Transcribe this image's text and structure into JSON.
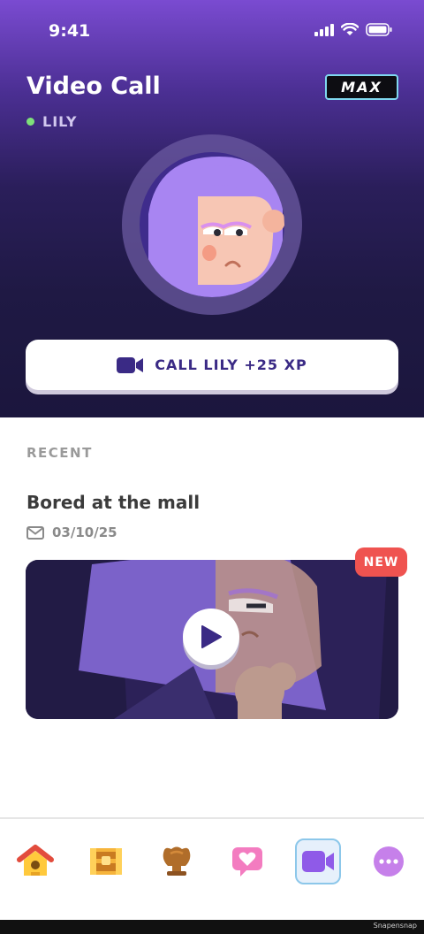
{
  "status": {
    "time": "9:41",
    "icons": [
      "signal-icon",
      "wifi-icon",
      "battery-icon"
    ]
  },
  "header": {
    "title": "Video Call",
    "badge": "MAX",
    "contact_name": "LILY",
    "online_color": "#7ee07a"
  },
  "call_button": {
    "label": "CALL LILY +25 XP",
    "icon": "video-camera-icon"
  },
  "recent": {
    "heading": "RECENT",
    "episodes": [
      {
        "title": "Bored at the mall",
        "date": "03/10/25",
        "date_icon": "mail-icon",
        "badge": "NEW",
        "badge_color": "#ef5350"
      }
    ]
  },
  "tabbar": {
    "items": [
      {
        "name": "home",
        "icon": "home-icon"
      },
      {
        "name": "chest",
        "icon": "treasure-chest-icon"
      },
      {
        "name": "trophy",
        "icon": "trophy-icon"
      },
      {
        "name": "hearts",
        "icon": "heart-message-icon"
      },
      {
        "name": "video-call",
        "icon": "video-camera-icon",
        "active": true
      },
      {
        "name": "more",
        "icon": "more-icon"
      }
    ]
  },
  "footer": {
    "watermark": "Snapensnap"
  },
  "colors": {
    "accent": "#3a2a85",
    "hero_top": "#7a4bd1",
    "hero_bottom": "#1b163d",
    "active_tab": "#8cc7ea"
  }
}
